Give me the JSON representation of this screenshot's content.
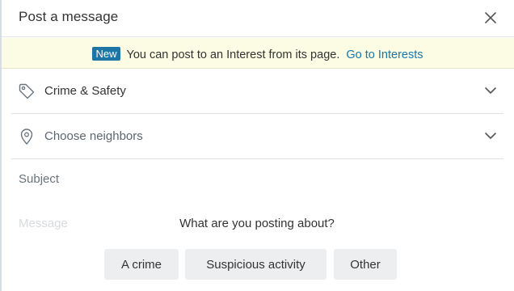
{
  "header": {
    "title": "Post a message",
    "close_icon": "close-icon"
  },
  "banner": {
    "badge": "New",
    "text": "You can post to an Interest from its page.",
    "link": "Go to Interests"
  },
  "category": {
    "icon": "tag-icon",
    "value": "Crime & Safety",
    "chevron": "chevron-down-icon"
  },
  "neighbors": {
    "icon": "location-pin-icon",
    "placeholder": "Choose neighbors",
    "chevron": "chevron-down-icon"
  },
  "subject": {
    "placeholder": "Subject"
  },
  "message": {
    "placeholder": "Message"
  },
  "prompt": {
    "text": "What are you posting about?",
    "options": [
      "A crime",
      "Suspicious activity",
      "Other"
    ]
  },
  "colors": {
    "accent": "#1a76a8",
    "badge_bg": "#1d75a5",
    "banner_bg": "#fcfbe4",
    "chip_bg": "#eceef0"
  }
}
